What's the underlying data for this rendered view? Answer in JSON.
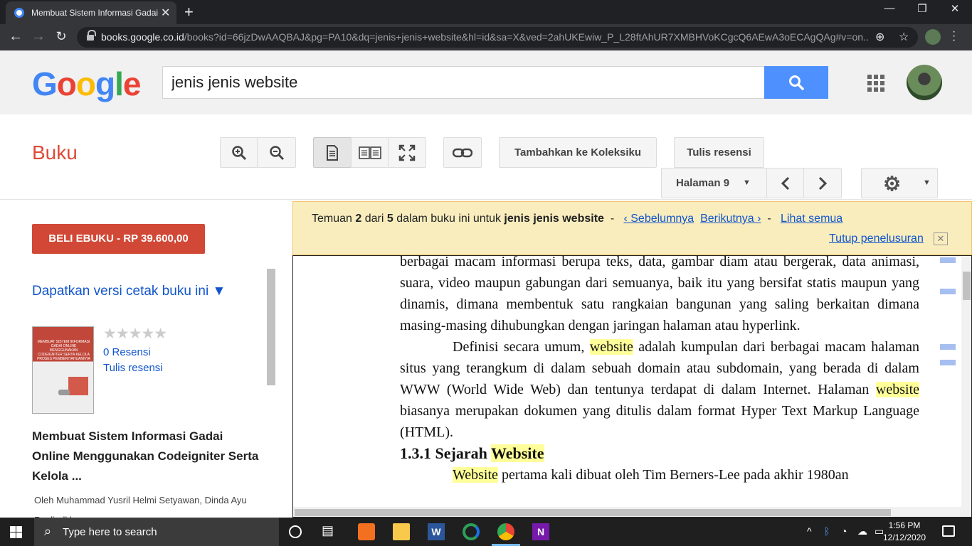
{
  "browser": {
    "tab_title": "Membuat Sistem Informasi Gadai",
    "url_host": "books.google.co.id",
    "url_path": "/books?id=66jzDwAAQBAJ&pg=PA10&dq=jenis+jenis+website&hl=id&sa=X&ved=2ahUKEwiw_P_L28ftAhUR7XMBHVoKCgcQ6AEwA3oECAgQAg#v=on..."
  },
  "google": {
    "logo": "Google",
    "search_value": "jenis jenis website"
  },
  "books_toolbar": {
    "section_title": "Buku",
    "add_collection": "Tambahkan ke Koleksiku",
    "write_review": "Tulis resensi",
    "page_select": "Halaman 9"
  },
  "sidebar": {
    "buy_button": "BELI EBUKU - RP 39.600,00",
    "print_version": "Dapatkan versi cetak buku ini ▼",
    "rating_stars": "★★★★★",
    "reviews_count": "0 Resensi",
    "write_review": "Tulis resensi",
    "cover_title": "MEMBUAT SISTEM INFORMASI GADAI ONLINE MENGGUNAKAN CODEIGNITER SERTA KELOLA PROSES PEMBERITAHUANNYA",
    "book_title": "Membuat Sistem Informasi Gadai Online Menggunakan Codeigniter Serta Kelola ...",
    "authors": "Oleh Muhammad Yusril Helmi Setyawan, Dinda Ayu Rusli, dkk"
  },
  "search_notice": {
    "prefix": "Temuan ",
    "current": "2",
    "mid1": " dari ",
    "total": "5",
    "mid2": " dalam buku ini untuk ",
    "query": "jenis jenis website",
    "sep1": "  -  ",
    "prev": "‹ Sebelumnya",
    "next": "Berikutnya ›",
    "sep2": "  -  ",
    "see_all": "Lihat semua",
    "close_search": "Tutup penelusuran",
    "close_x": "✕"
  },
  "page": {
    "p1": "berbagai macam informasi berupa teks, data, gambar diam atau bergerak, data animasi, suara, video maupun gabungan dari semuanya, baik itu yang bersifat statis maupun yang dinamis, dimana membentuk satu rangkaian bangunan yang saling berkaitan dimana masing-masing dihubungkan dengan jaringan halaman atau hyperlink.",
    "p2_a": "Definisi secara umum, ",
    "p2_hl1": "website",
    "p2_b": " adalah kumpulan dari berbagai macam halaman situs yang terangkum di dalam sebuah domain atau subdomain, yang berada di dalam WWW (World Wide Web) dan tentunya terdapat di dalam Internet. Halaman ",
    "p2_hl2": "website",
    "p2_c": " biasanya merupakan dokumen yang ditulis dalam format Hyper Text Markup Language (HTML).",
    "heading_a": "1.3.1 Sejarah ",
    "heading_hl": "Website",
    "p3_hl": "Website",
    "p3_a": " pertama kali dibuat oleh Tim Berners-Lee pada akhir 1980an"
  },
  "taskbar": {
    "search_placeholder": "Type here to search",
    "time": "1:56 PM",
    "date": "12/12/2020"
  },
  "colors": {
    "buy_button": "#d14836",
    "link": "#1155cc",
    "notice_bg": "#f9edbe",
    "highlight": "#ffff99"
  }
}
